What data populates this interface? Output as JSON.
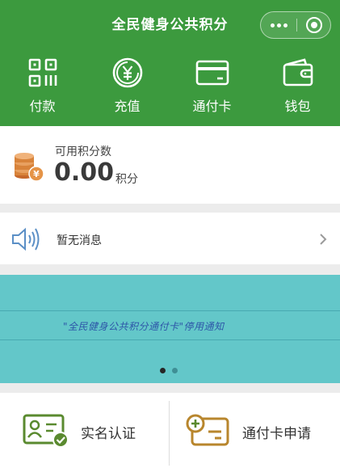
{
  "header": {
    "title": "全民健身公共积分",
    "background": "#3c9a3e",
    "tools": [
      {
        "label": "付款",
        "icon": "qr-code-icon"
      },
      {
        "label": "充值",
        "icon": "yuan-coin-icon"
      },
      {
        "label": "通付卡",
        "icon": "card-icon"
      },
      {
        "label": "钱包",
        "icon": "wallet-icon"
      }
    ]
  },
  "points": {
    "label": "可用积分数",
    "value": "0.00",
    "unit": "积分",
    "icon": "coin-stack-icon",
    "coin_symbol": "¥"
  },
  "notice": {
    "text": "暂无消息",
    "icon": "speaker-icon"
  },
  "banner": {
    "text": "\"全民健身公共积分通付卡\"停用通知",
    "background": "#63c7c9",
    "text_color": "#2d55a8",
    "page_count": 2,
    "active_page": 1
  },
  "bottom": {
    "items": [
      {
        "label": "实名认证",
        "icon": "id-card-verified-icon"
      },
      {
        "label": "通付卡申请",
        "icon": "card-apply-icon"
      }
    ],
    "accent": "#5a8a2f",
    "accent_orange": "#b8862d"
  }
}
